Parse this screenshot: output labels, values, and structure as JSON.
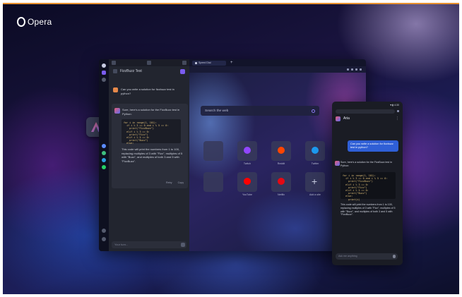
{
  "brand": {
    "name": "Opera"
  },
  "browser": {
    "chat": {
      "title": "FizzBuzz Test",
      "user_message": "Can you write a solution for fizzbuzz test in python?",
      "aria_intro": "Sure, here's a solution for the FizzBuzz test in Python:",
      "code_lines": [
        "for i in range(1, 101):",
        "  if i % 3 == 0 and i % 5 == 0:",
        "    print(\"FizzBuzz\")",
        "  elif i % 3 == 0:",
        "    print(\"Fizz\")",
        "  elif i % 5 == 0:",
        "    print(\"Buzz\")",
        "  else:",
        "    print(i)"
      ],
      "aria_outro": "This code will print the numbers from 1 to 100, replacing multiples of 3 with \"Fizz\", multiples of 5 with \"Buzz\", and multiples of both 3 and 5 with \"FizzBuzz\".",
      "actions": [
        "Retry",
        "Copy"
      ],
      "input_placeholder": "Your turn..."
    },
    "tab": {
      "label": "Speed Dial"
    },
    "search_placeholder": "Search the web",
    "speed_dial": [
      {
        "label": "Twitch",
        "color": "#9146ff"
      },
      {
        "label": "Reddit",
        "color": "#ff4500"
      },
      {
        "label": "Twitter",
        "color": "#1d9bf0"
      },
      {
        "label": "YouTube",
        "color": "#ff0000"
      },
      {
        "label": "Netflix",
        "color": "#e50914"
      },
      {
        "label": "Add a site",
        "color": "#8d92b2"
      }
    ]
  },
  "phone": {
    "status": "▼▮ 4:30",
    "title": "Aria",
    "user_message": "Can you write a solution for fizzbuzz test in python?",
    "aria_intro": "Sure, here's a solution for the FizzBuzz test in Python:",
    "code_lines": [
      "for i in range(1, 101):",
      "  if i % 3 == 0 and i % 5 == 0:",
      "    print(\"FizzBuzz\")",
      "  elif i % 3 == 0:",
      "    print(\"Fizz\")",
      "  elif i % 5 == 0:",
      "    print(\"Buzz\")",
      "  else:",
      "    print(i)"
    ],
    "aria_outro": "This code will print the numbers from 1 to 100, replacing multiples of 3 with \"Fizz\", multiples of 5 with \"Buzz\", and multiples of both 3 and 5 with \"FizzBuzz\".",
    "input_placeholder": "Ask me anything"
  },
  "colors": {
    "accent": "#7b5cf0",
    "brand_bar": "#e8912f"
  }
}
